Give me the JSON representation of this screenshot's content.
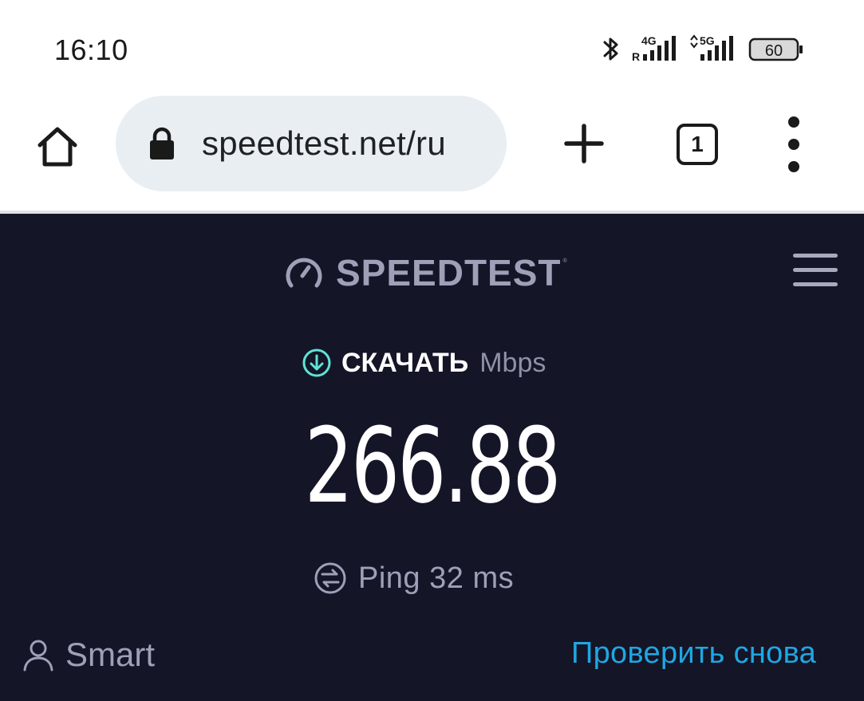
{
  "status_bar": {
    "time": "16:10",
    "icons": [
      "bluetooth-icon",
      "signal-4g-roaming-icon",
      "signal-5g-icon",
      "battery-icon"
    ],
    "network_1": "4G",
    "roaming": "R",
    "network_2": "5G",
    "battery_level": "60"
  },
  "browser": {
    "url": "speedtest.net/ru",
    "tab_count": "1",
    "icons": [
      "home-icon",
      "lock-icon",
      "plus-icon",
      "tabs-icon",
      "more-vert-icon"
    ]
  },
  "speedtest": {
    "brand": "SPEEDTEST",
    "brand_mark": "®",
    "download_label": "СКАЧАТЬ",
    "unit": "Mbps",
    "download_value": "266.88",
    "ping_text": "Ping 32 ms",
    "mode_label": "Smart",
    "retry_label": "Проверить снова"
  },
  "colors": {
    "page_background": "#141527",
    "accent_link": "#1fa7e3",
    "download_icon": "#5fe3d6",
    "muted_text": "#9ea0b8"
  }
}
